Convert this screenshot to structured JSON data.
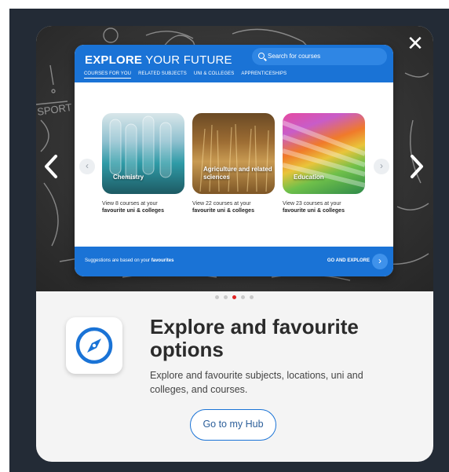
{
  "modal": {
    "close_glyph": "✕",
    "arrow_left_icon": "chevron-left-icon",
    "arrow_right_icon": "chevron-right-icon"
  },
  "card": {
    "brand_bold": "EXPLORE",
    "brand_light": " YOUR FUTURE",
    "search_placeholder": "Search for courses",
    "tabs": [
      "COURSES FOR YOU",
      "RELATED SUBJECTS",
      "UNI & COLLEGES",
      "APPRENTICESHIPS"
    ],
    "courses": [
      {
        "name": "Chemistry",
        "count_text": "View 8 courses at your",
        "sub_text": "favourite uni & colleges"
      },
      {
        "name": "Agriculture and related sciences",
        "count_text": "View 22 courses at your",
        "sub_text": "favourite uni & colleges"
      },
      {
        "name": "Education",
        "count_text": "View 23 courses at your",
        "sub_text": "favourite uni & colleges"
      }
    ],
    "foot_note_prefix": "Suggestions are based on your ",
    "foot_note_bold": "favourites",
    "foot_cta_prefix": "GO AND ",
    "foot_cta_bold": "EXPLORE"
  },
  "pager": {
    "total": 5,
    "active_index": 2
  },
  "feature": {
    "icon": "compass-icon",
    "title": "Explore and favourite options",
    "description": "Explore and favourite subjects, locations, uni and colleges, and courses.",
    "button_label": "Go to my Hub"
  },
  "colors": {
    "backdrop": "#232b36",
    "brand_blue": "#1a73d6",
    "pager_active": "#e02323"
  }
}
